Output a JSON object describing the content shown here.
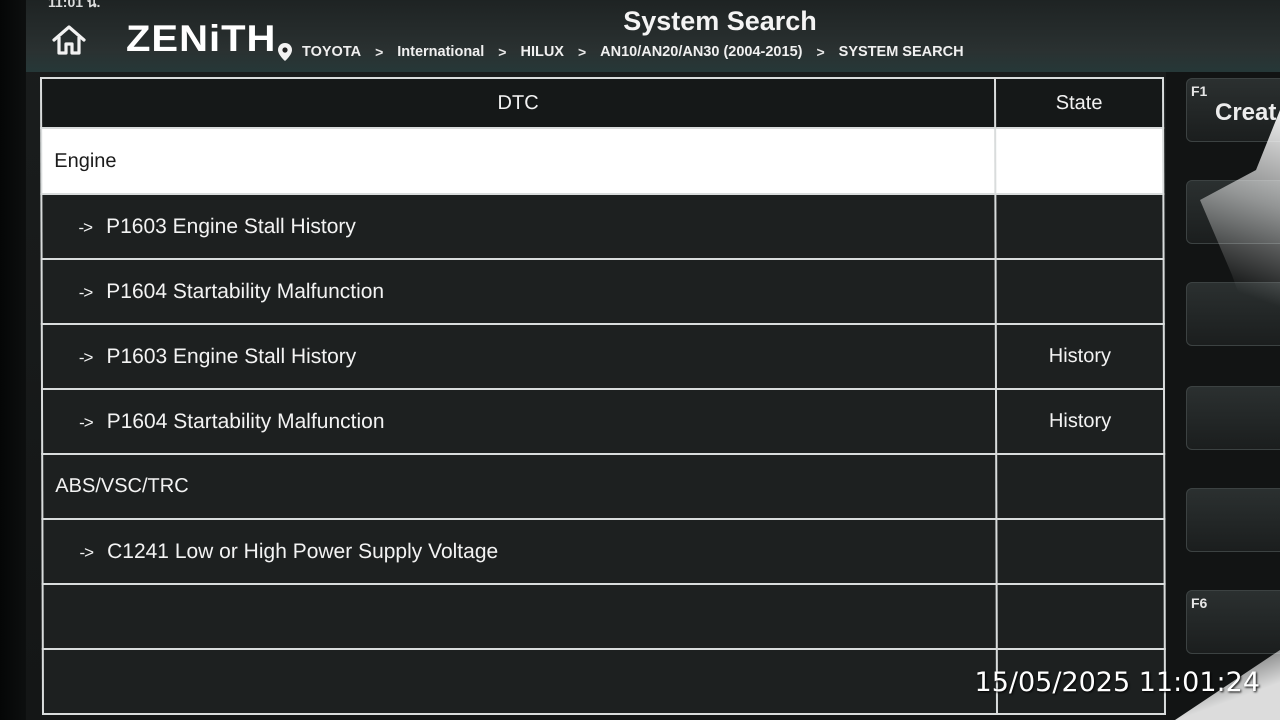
{
  "status_bar": {
    "time": "11:01 น."
  },
  "header": {
    "brand": "ZENiTH",
    "title": "System Search",
    "breadcrumb": [
      "TOYOTA",
      "International",
      "HILUX",
      "AN10/AN20/AN30 (2004-2015)",
      "SYSTEM SEARCH"
    ],
    "separator": ">"
  },
  "table": {
    "columns": {
      "dtc": "DTC",
      "state": "State"
    },
    "rows": [
      {
        "type": "group",
        "dtc": "Engine",
        "arrow": "",
        "state": "",
        "selected": true
      },
      {
        "type": "code",
        "arrow": "->",
        "dtc": "P1603 Engine Stall History",
        "state": ""
      },
      {
        "type": "code",
        "arrow": "->",
        "dtc": "P1604 Startability Malfunction",
        "state": ""
      },
      {
        "type": "code",
        "arrow": "->",
        "dtc": "P1603 Engine Stall History",
        "state": "History"
      },
      {
        "type": "code",
        "arrow": "->",
        "dtc": "P1604 Startability Malfunction",
        "state": "History"
      },
      {
        "type": "group",
        "arrow": "",
        "dtc": "ABS/VSC/TRC",
        "state": ""
      },
      {
        "type": "code",
        "arrow": "->",
        "dtc": "C1241 Low or High Power Supply Voltage",
        "state": ""
      },
      {
        "type": "empty",
        "arrow": "",
        "dtc": "",
        "state": ""
      },
      {
        "type": "empty",
        "arrow": "",
        "dtc": "",
        "state": ""
      }
    ]
  },
  "function_keys": [
    {
      "key": "F1",
      "label": "Creat"
    },
    {
      "key": "",
      "label": ""
    },
    {
      "key": "",
      "label": ""
    },
    {
      "key": "",
      "label": ""
    },
    {
      "key": "",
      "label": ""
    },
    {
      "key": "F6",
      "label": ""
    }
  ],
  "overlay": {
    "timestamp": "15/05/2025 11:01:24"
  },
  "icons": {
    "home": "home-icon",
    "location": "location-pin-icon"
  },
  "colors": {
    "background": "#1d2020",
    "selected_row": "#ffffff",
    "border": "#d9dcdc"
  }
}
